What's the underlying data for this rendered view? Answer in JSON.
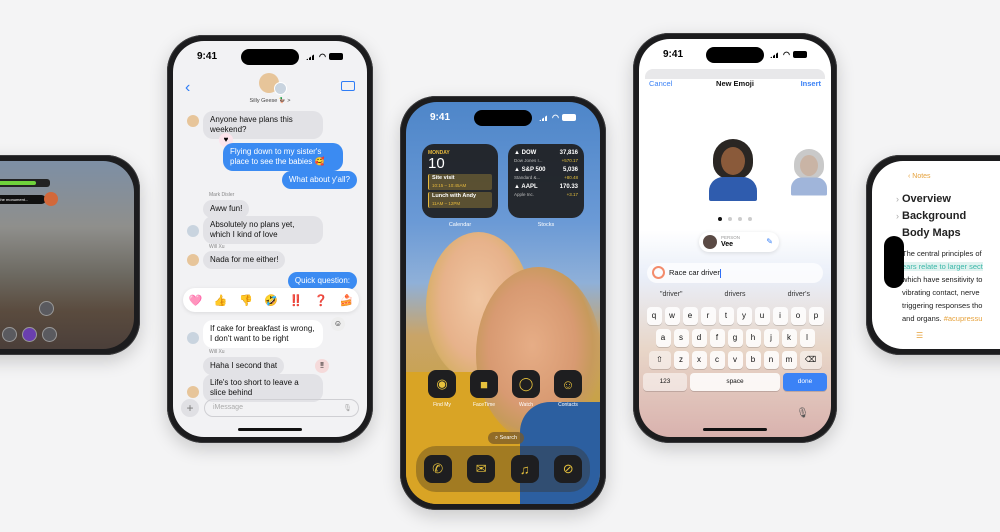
{
  "status_time": "9:41",
  "game": {
    "chat_text": "Can't believe that was in the monument...",
    "health_fraction": 0.8,
    "buttons": [
      "square",
      "cross",
      "triangle",
      "circle",
      "l1"
    ]
  },
  "messages": {
    "group_name": "Silly Geese 🦆 >",
    "items": [
      {
        "dir": "in",
        "sender": "",
        "text": "Anyone have plans this weekend?"
      },
      {
        "dir": "out",
        "text": "Flying down to my sister's place to see the babies 🥰"
      },
      {
        "dir": "out",
        "text": "What about y'all?"
      },
      {
        "dir": "in",
        "sender": "Mark Disler",
        "text": "Aww fun!"
      },
      {
        "dir": "in",
        "sender": "",
        "text": "Absolutely no plans yet, which I kind of love"
      },
      {
        "dir": "in",
        "sender": "Will Xu",
        "text": "Nada for me either!"
      },
      {
        "dir": "out",
        "text": "Quick question:"
      },
      {
        "dir": "in",
        "sender": "",
        "text": "If cake for breakfast is wrong, I don't want to be right"
      },
      {
        "dir": "in",
        "sender": "Will Xu",
        "text": "Haha I second that"
      },
      {
        "dir": "in",
        "sender": "",
        "text": "Life's too short to leave a slice behind"
      }
    ],
    "tapbacks": [
      "🩷",
      "👍",
      "👎",
      "🤣",
      "‼️",
      "❓",
      "🍰"
    ],
    "input_placeholder": "iMessage",
    "plus_label": "+",
    "back_label": "‹"
  },
  "home": {
    "calendar": {
      "day": "MONDAY",
      "date": "10",
      "events": [
        {
          "title": "Site visit",
          "time": "10:15 – 10:45AM"
        },
        {
          "title": "Lunch with Andy",
          "time": "11AM – 12PM"
        }
      ],
      "label": "Calendar"
    },
    "stocks": {
      "rows": [
        {
          "sym": "▲ DOW",
          "name": "Dow Jones I...",
          "price": "37,816",
          "change": "+570.17"
        },
        {
          "sym": "▲ S&P 500",
          "name": "Standard &...",
          "price": "5,036",
          "change": "+80.48"
        },
        {
          "sym": "▲ AAPL",
          "name": "Apple Inc.",
          "price": "170.33",
          "change": "+3.17"
        }
      ],
      "label": "Stocks"
    },
    "apps": [
      {
        "name": "Find My",
        "glyph": "◉"
      },
      {
        "name": "FaceTime",
        "glyph": "■"
      },
      {
        "name": "Watch",
        "glyph": "◯"
      },
      {
        "name": "Contacts",
        "glyph": "☺"
      }
    ],
    "search_label": "⌕ Search",
    "dock": [
      {
        "name": "Phone",
        "glyph": "✆"
      },
      {
        "name": "Mail",
        "glyph": "✉"
      },
      {
        "name": "Music",
        "glyph": "♫"
      },
      {
        "name": "Safari",
        "glyph": "⊘"
      }
    ]
  },
  "emoji": {
    "cancel": "Cancel",
    "title": "New Emoji",
    "insert": "Insert",
    "person_label": "PERSON",
    "person_name": "Vee",
    "prompt": "Race car driver",
    "suggestions": [
      "\"driver\"",
      "drivers",
      "driver's"
    ],
    "keyboard": {
      "row1": [
        "q",
        "w",
        "e",
        "r",
        "t",
        "y",
        "u",
        "i",
        "o",
        "p"
      ],
      "row2": [
        "a",
        "s",
        "d",
        "f",
        "g",
        "h",
        "j",
        "k",
        "l"
      ],
      "row3": [
        "z",
        "x",
        "c",
        "v",
        "b",
        "n",
        "m"
      ],
      "shift": "⇧",
      "delete": "⌫",
      "num": "123",
      "space": "space",
      "done": "done",
      "mic": "🎙"
    },
    "page_count": 4,
    "page_active": 1
  },
  "notes": {
    "back": "‹ Notes",
    "headings": [
      "Overview",
      "Background",
      "Body Maps"
    ],
    "body_lines": [
      {
        "text": "The central principles of",
        "style": ""
      },
      {
        "text": "ears relate to larger sect",
        "style": "hl"
      },
      {
        "text": "which have sensitivity to",
        "style": ""
      },
      {
        "text": "vibrating contact, nerve",
        "style": ""
      },
      {
        "text": "triggering responses tho",
        "style": ""
      },
      {
        "text": "and organs. ",
        "style": "",
        "tag": "#acupressu"
      }
    ]
  }
}
